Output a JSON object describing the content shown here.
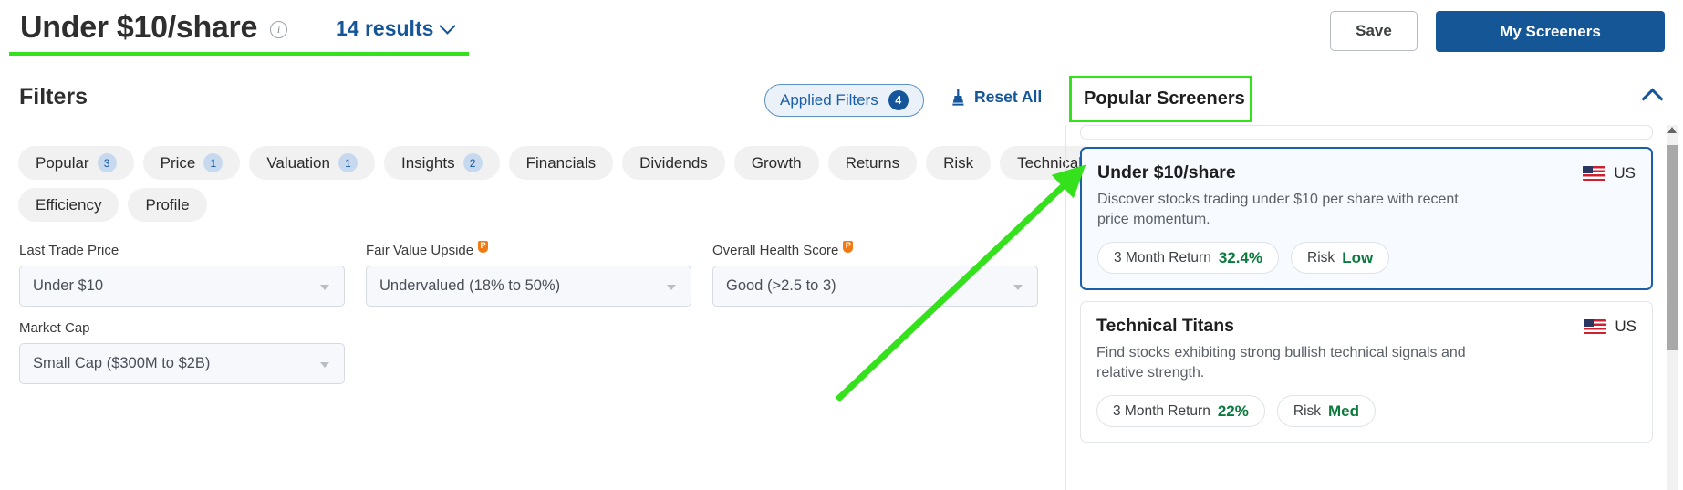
{
  "header": {
    "title": "Under $10/share",
    "info_icon": "info-icon",
    "results_label": "14 results",
    "save_label": "Save",
    "my_screeners_label": "My Screeners",
    "accent_green": "#35e01c",
    "accent_blue": "#15569b"
  },
  "filters_bar": {
    "heading": "Filters",
    "applied_filters_label": "Applied Filters",
    "applied_filters_count": "4",
    "reset_all_label": "Reset All",
    "reset_icon": "broom-icon",
    "popular_screeners_label": "Popular Screeners",
    "collapse_icon": "chevron-up-icon"
  },
  "pills": [
    [
      {
        "label": "Popular",
        "count": "3"
      },
      {
        "label": "Price",
        "count": "1"
      },
      {
        "label": "Valuation",
        "count": "1"
      },
      {
        "label": "Insights",
        "count": "2"
      },
      {
        "label": "Financials",
        "count": null
      },
      {
        "label": "Dividends",
        "count": null
      },
      {
        "label": "Growth",
        "count": null
      },
      {
        "label": "Returns",
        "count": null
      },
      {
        "label": "Risk",
        "count": null
      },
      {
        "label": "Technical",
        "count": null
      }
    ],
    [
      {
        "label": "Efficiency",
        "count": null
      },
      {
        "label": "Profile",
        "count": null
      }
    ]
  ],
  "fields": [
    [
      {
        "label": "Last Trade Price",
        "value": "Under $10",
        "premium": false
      },
      {
        "label": "Fair Value Upside",
        "value": "Undervalued (18% to 50%)",
        "premium": true
      },
      {
        "label": "Overall Health Score",
        "value": "Good (>2.5 to 3)",
        "premium": true
      }
    ],
    [
      {
        "label": "Market Cap",
        "value": "Small Cap ($300M to $2B)",
        "premium": false
      }
    ]
  ],
  "right_panel": {
    "cards": [
      {
        "title": "Under $10/share",
        "region": "US",
        "flag": "us-flag-icon",
        "description": "Discover stocks trading under $10 per share with recent price momentum.",
        "selected": true,
        "chips": [
          {
            "label": "3 Month Return",
            "value": "32.4%"
          },
          {
            "label": "Risk",
            "value": "Low"
          }
        ]
      },
      {
        "title": "Technical Titans",
        "region": "US",
        "flag": "us-flag-icon",
        "description": "Find stocks exhibiting strong bullish technical signals and relative strength.",
        "selected": false,
        "chips": [
          {
            "label": "3 Month Return",
            "value": "22%"
          },
          {
            "label": "Risk",
            "value": "Med"
          }
        ]
      }
    ]
  },
  "annotation": {
    "arrow_color": "#35e01c",
    "points_to": "Under $10/share screener card"
  }
}
